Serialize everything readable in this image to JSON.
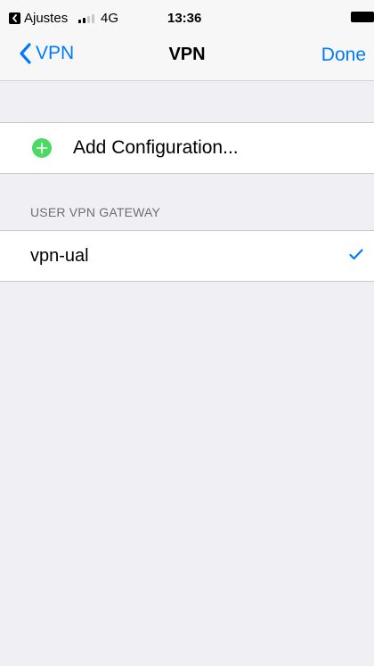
{
  "status_bar": {
    "back_app_label": "Ajustes",
    "network": "4G",
    "time": "13:36",
    "signal_bars": 4,
    "signal_bars_active": 2,
    "battery_level": 1.0
  },
  "nav": {
    "back_label": "VPN",
    "title": "VPN",
    "done_label": "Done"
  },
  "add_configuration": {
    "label": "Add Configuration...",
    "icon": "plus-circle-icon"
  },
  "section": {
    "header": "USER VPN GATEWAY"
  },
  "vpn_list": [
    {
      "name": "vpn-ual",
      "selected": true
    }
  ],
  "colors": {
    "accent": "#007aff",
    "add_icon": "#4cd964",
    "background": "#efeff4"
  }
}
